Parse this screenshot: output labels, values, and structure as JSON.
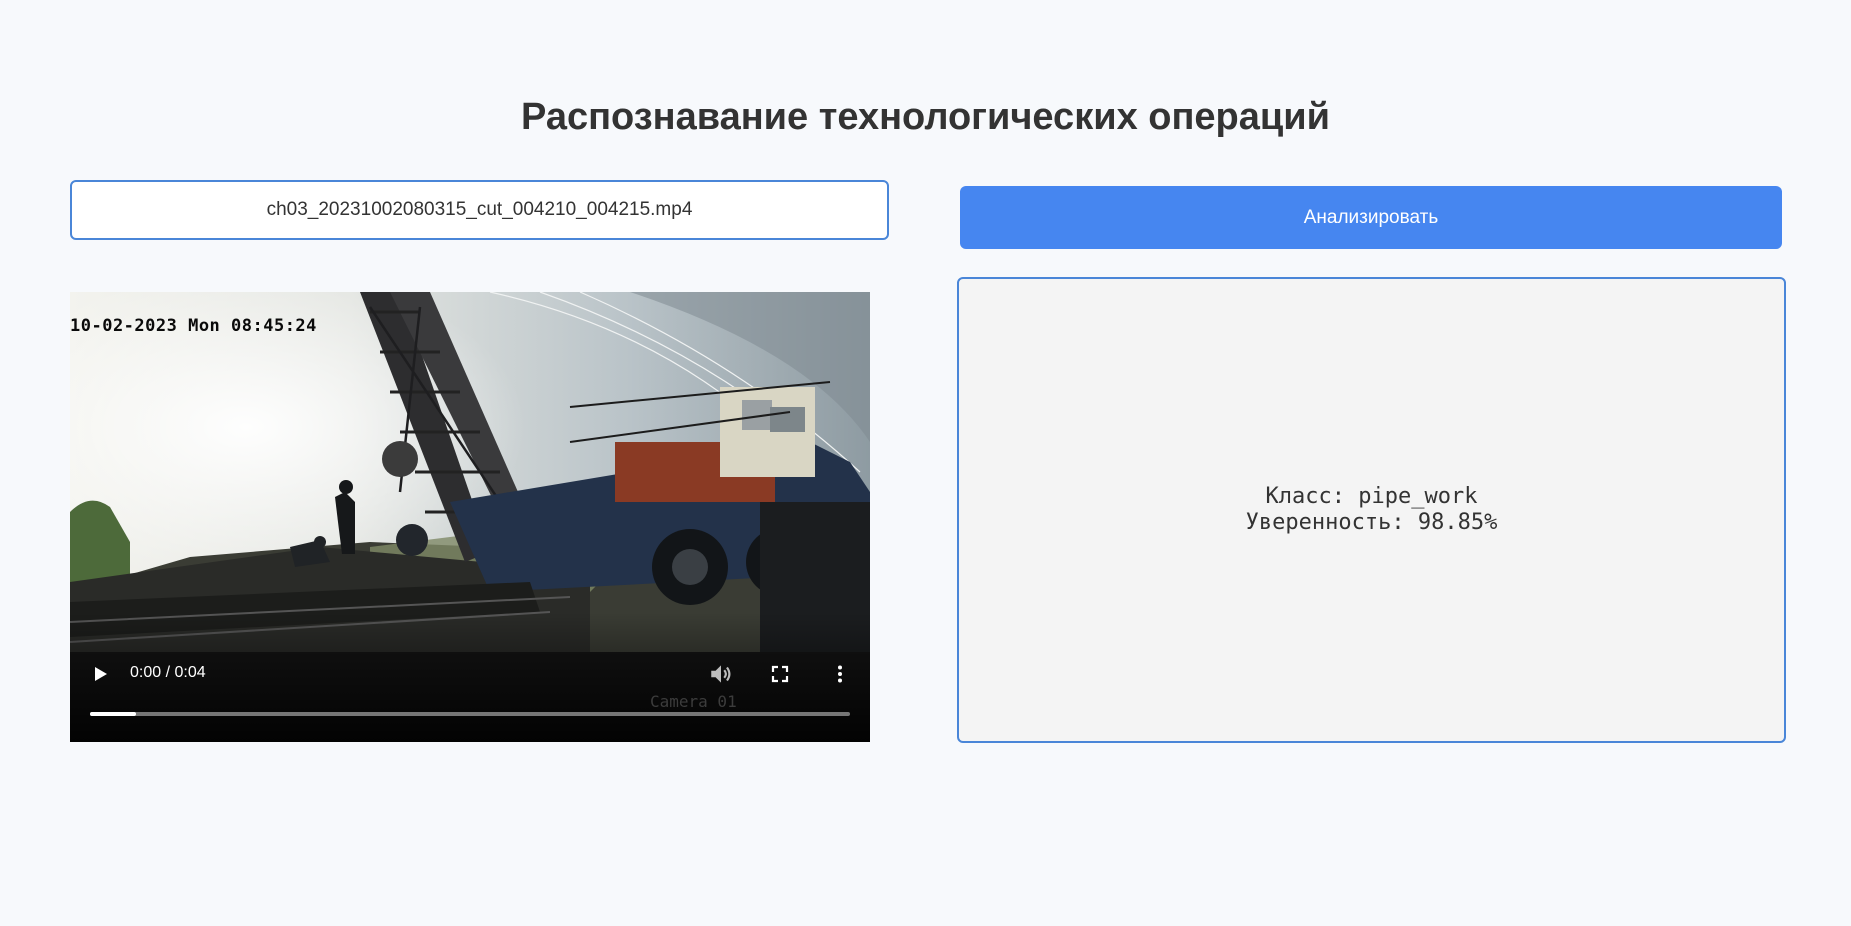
{
  "page": {
    "title": "Распознавание технологических операций"
  },
  "file_input": {
    "filename": "ch03_20231002080315_cut_004210_004215.mp4"
  },
  "analyze_button": {
    "label": "Анализировать",
    "color": "#4686f0"
  },
  "video": {
    "osd_timestamp": "10-02-2023 Mon 08:45:24",
    "osd_camera": "Camera 01",
    "controls": {
      "time": "0:00 / 0:04",
      "progress": 0.06,
      "icons": [
        "play-icon",
        "volume-icon",
        "fullscreen-icon",
        "more-vertical-icon"
      ]
    }
  },
  "result": {
    "class_line": "Класс: pipe_work",
    "confidence_line": "Уверенность: 98.85%"
  },
  "colors": {
    "accent": "#4686f0",
    "border": "#4a86d8",
    "background": "#f7f9fc",
    "panel": "#f4f4f4"
  }
}
